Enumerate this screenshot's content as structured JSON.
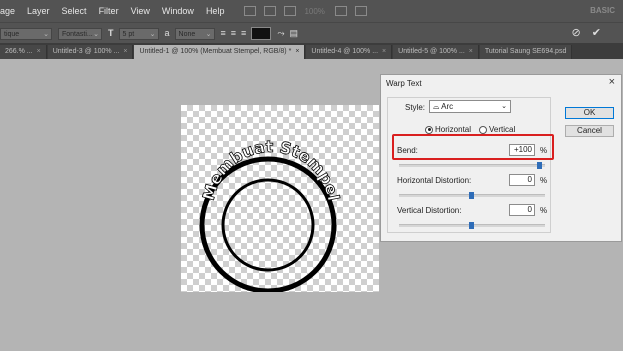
{
  "menubar": {
    "items": [
      "age",
      "Layer",
      "Select",
      "Filter",
      "View",
      "Window",
      "Help"
    ],
    "zoom": "100%",
    "workspace": "BASIC"
  },
  "optionsbar": {
    "font_family": "tique",
    "font_style": "Fontasti...",
    "size_icon": "T",
    "font_size": "5 pt",
    "aa_icon": "a",
    "antialias": "None"
  },
  "tabs": [
    {
      "label": "266.% ...",
      "active": false
    },
    {
      "label": "Untitled-3 @ 100% ...",
      "active": false
    },
    {
      "label": "Untitled-1 @ 100% (Membuat Stempel, RGB/8) *",
      "active": true
    },
    {
      "label": "Untitled-4 @ 100% ...",
      "active": false
    },
    {
      "label": "Untitled-5 @ 100% ...",
      "active": false
    },
    {
      "label": "Tutorial Saung SE694.psd",
      "active": false
    }
  ],
  "canvas": {
    "stamp_text": "Membuat Stempel"
  },
  "dialog": {
    "title": "Warp Text",
    "close": "×",
    "style_label": "Style:",
    "style_icon": "arc-icon",
    "style_value": "Arc",
    "horizontal_label": "Horizontal",
    "vertical_label": "Vertical",
    "orientation": "Horizontal",
    "bend_label": "Bend:",
    "bend_value": "+100",
    "hdist_label": "Horizontal Distortion:",
    "hdist_value": "0",
    "vdist_label": "Vertical Distortion:",
    "vdist_value": "0",
    "percent": "%",
    "ok_label": "OK",
    "cancel_label": "Cancel",
    "bend_slider": 1.0,
    "hdist_slider": 0.5,
    "vdist_slider": 0.5
  },
  "colors": {
    "highlight": "#d91f1f",
    "slider_thumb": "#2f6db8"
  }
}
